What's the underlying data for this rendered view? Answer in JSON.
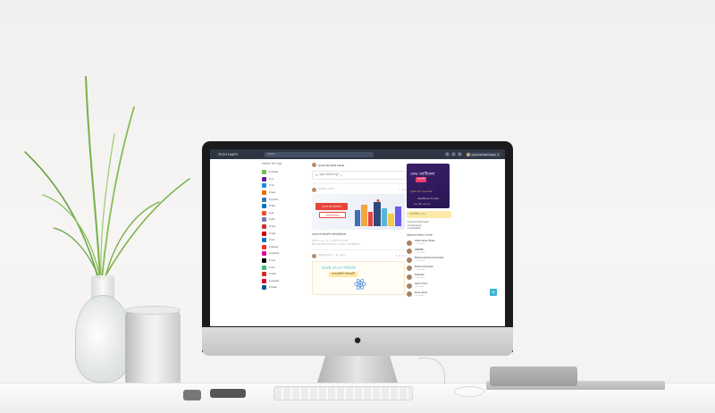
{
  "app": {
    "brand": "TECH DIARY",
    "search_placeholder": "Search",
    "user_name": "Quazi Md Mahi Faisal"
  },
  "left_sidebar": {
    "title": "নির্বাচিত ট্যাগ সমূহ",
    "tags": [
      {
        "label": "# nodejs",
        "color": "#6cc24a"
      },
      {
        "label": "# cs",
        "color": "#6a1b9a"
      },
      {
        "label": "# ios",
        "color": "#1e88e5"
      },
      {
        "label": "# java",
        "color": "#e76f00"
      },
      {
        "label": "# python",
        "color": "#3776ab"
      },
      {
        "label": "# dart",
        "color": "#0175c2"
      },
      {
        "label": "# git",
        "color": "#f05032"
      },
      {
        "label": "# php",
        "color": "#777bb4"
      },
      {
        "label": "# ruby",
        "color": "#cc342d"
      },
      {
        "label": "# rails",
        "color": "#cc0000"
      },
      {
        "label": "# css",
        "color": "#1572b6"
      },
      {
        "label": "# laravel",
        "color": "#ff2d20"
      },
      {
        "label": "# graphql",
        "color": "#e10098"
      },
      {
        "label": "# rust",
        "color": "#000000"
      },
      {
        "label": "# vue",
        "color": "#42b883"
      },
      {
        "label": "# redis",
        "color": "#d82c20"
      },
      {
        "label": "# angular",
        "color": "#dd0031"
      },
      {
        "label": "# flutter",
        "color": "#02569b"
      }
    ]
  },
  "feed": {
    "author": "Quazi Md Mahi Faisal",
    "composer_placeholder": "নতুন ডায়েরি লিখুন",
    "post1": {
      "author": "আরাফাত হোসেন",
      "likes": "0",
      "banner_label_1": "ওয়েব অ্যাপ্লিকেশন",
      "banner_label_2": "আর্কিটেকচার",
      "title": "ওয়েব অ্যাপ্লিকেশন আর্কিটেকচার",
      "meta_1": "প্রকাশিত: ৪ মে, ২০২২, প্রকাশকাল ৩মিনিট",
      "meta_2": "#ওয়েব #অ্যাপ্লিকেশন #ওয়েব অ্যাপ্লিকেশন #আর্কিটেকচার"
    },
    "post2": {
      "author": "মাহমুদুল হাসান · ২ মে, ২০২২",
      "likes": "4",
      "banner_line_1": "রিয়েক্ট জেএস পরিচিতি",
      "banner_line_2": "জাভাস্ক্রিপ্ট লাইব্রেরী"
    }
  },
  "right_sidebar": {
    "ad": {
      "line1": "ডেভ আর্টিকেল",
      "line2": "কন্টেস্ট",
      "line3": "পুরস্কার মূল্য ৫০০০ টাকা",
      "line4": "রেজিস্ট্রেশনের শেষ তারিখ",
      "line5": "৩০ মে, ২০২২"
    },
    "promo": "অ্যাকাউন্ট এ যাও",
    "links": [
      "Quazi Md Mahi Faisal",
      "Shoaib Rayan",
      "Imraj Rakhan"
    ],
    "people_title": "আমাদের নির্বাচিত সদস্যরা",
    "people": [
      {
        "name": "Ashik Jaman Shiam",
        "meta": "১৫টি ডায়েরি"
      },
      {
        "name": "DIRMRF",
        "meta": "১৩টি ডায়েরি"
      },
      {
        "name": "Mohammad Nyonul Hossain",
        "meta": "১২টি ডায়েরি"
      },
      {
        "name": "Mohsin Tanvosain",
        "meta": "১১টি ডায়েরি"
      },
      {
        "name": "Pushpak",
        "meta": "১০টি ডায়েরি"
      },
      {
        "name": "Arifur's Tech",
        "meta": "৯টি ডায়েরি"
      },
      {
        "name": "Zunai Jacob",
        "meta": "৯টি ডায়েরি"
      }
    ]
  }
}
